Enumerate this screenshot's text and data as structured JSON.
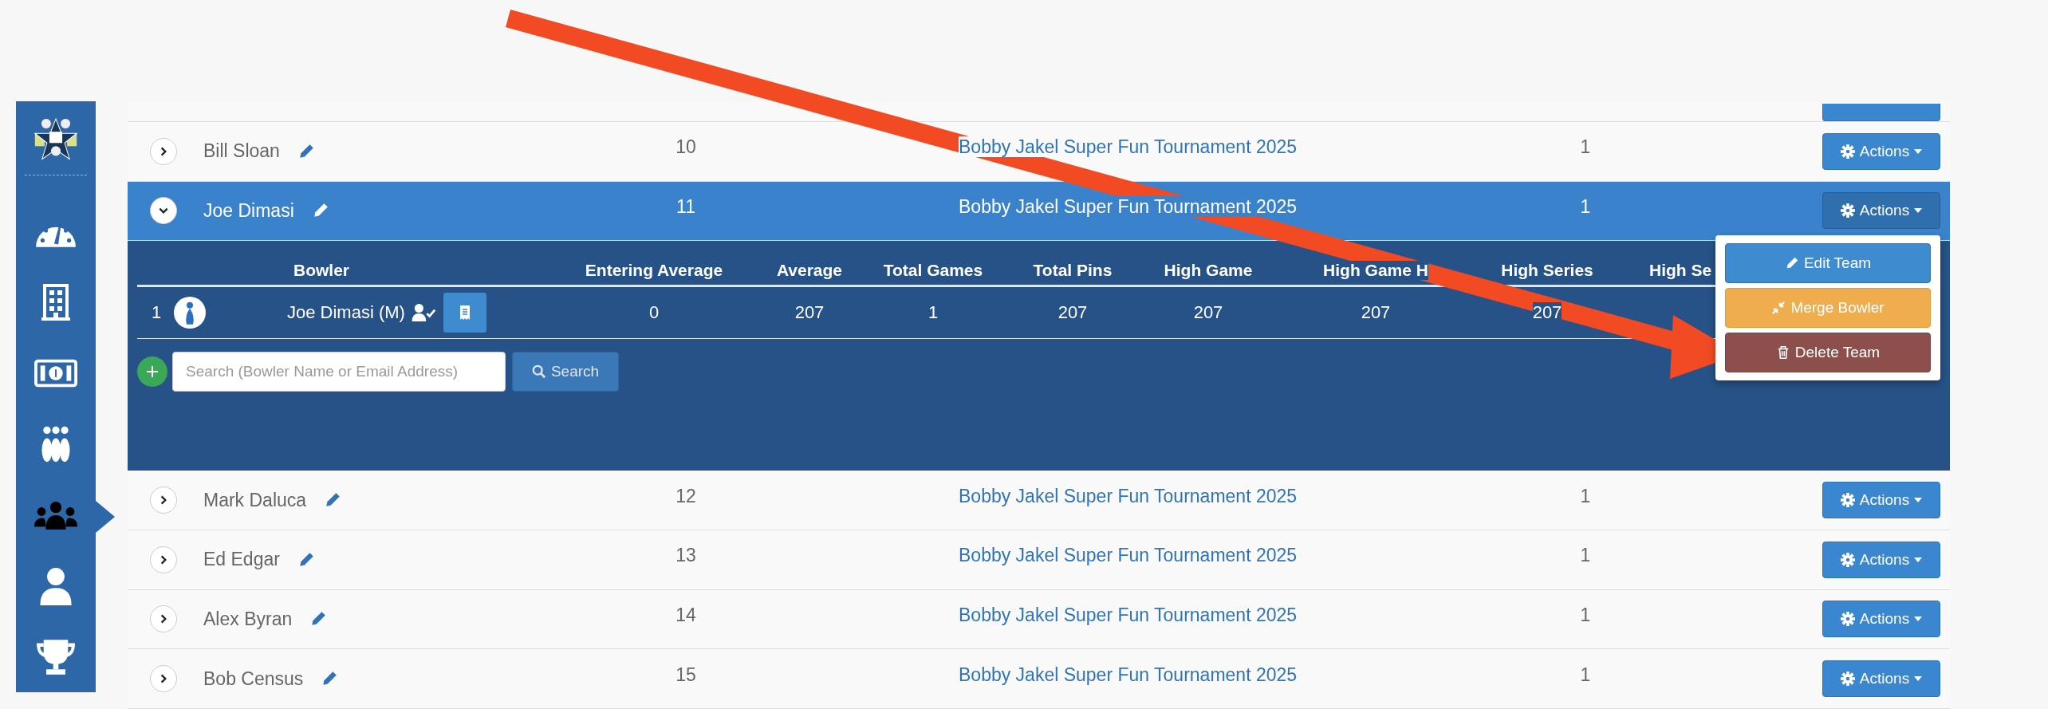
{
  "sidebar": {
    "items": [
      {
        "kind": "gauge",
        "selected": false
      },
      {
        "kind": "building",
        "selected": false
      },
      {
        "kind": "money",
        "selected": false
      },
      {
        "kind": "pins",
        "selected": false
      },
      {
        "kind": "team",
        "selected": true
      },
      {
        "kind": "user",
        "selected": false
      },
      {
        "kind": "trophy",
        "selected": false
      }
    ]
  },
  "teams": [
    {
      "name": "Bill Sloan",
      "number": "10",
      "tournament": "Bobby Jakel Super Fun Tournament 2025",
      "count": "1",
      "actions": "Actions",
      "expanded": false,
      "menu_open": false
    },
    {
      "name": "Joe Dimasi",
      "number": "11",
      "tournament": "Bobby Jakel Super Fun Tournament 2025",
      "count": "1",
      "actions": "Actions",
      "expanded": true,
      "menu_open": true
    },
    {
      "name": "Mark Daluca",
      "number": "12",
      "tournament": "Bobby Jakel Super Fun Tournament 2025",
      "count": "1",
      "actions": "Actions",
      "expanded": false,
      "menu_open": false
    },
    {
      "name": "Ed Edgar",
      "number": "13",
      "tournament": "Bobby Jakel Super Fun Tournament 2025",
      "count": "1",
      "actions": "Actions",
      "expanded": false,
      "menu_open": false
    },
    {
      "name": "Alex Byran",
      "number": "14",
      "tournament": "Bobby Jakel Super Fun Tournament 2025",
      "count": "1",
      "actions": "Actions",
      "expanded": false,
      "menu_open": false
    },
    {
      "name": "Bob Census",
      "number": "15",
      "tournament": "Bobby Jakel Super Fun Tournament 2025",
      "count": "1",
      "actions": "Actions",
      "expanded": false,
      "menu_open": false
    }
  ],
  "actions_menu": [
    {
      "label": "Edit Team",
      "kind": "edit"
    },
    {
      "label": "Merge Bowler",
      "kind": "merge"
    },
    {
      "label": "Delete Team",
      "kind": "delete"
    }
  ],
  "detail": {
    "columns": [
      "Bowler",
      "Entering Average",
      "Average",
      "Total Games",
      "Total Pins",
      "High Game",
      "High Game H",
      "High Series",
      "High Se"
    ],
    "rows": [
      {
        "index": "1",
        "bowler": "Joe Dimasi (M)",
        "values": [
          "0",
          "207",
          "1",
          "207",
          "207",
          "207",
          "207"
        ]
      }
    ],
    "search": {
      "placeholder": "Search (Bowler Name or Email Address)",
      "button": "Search"
    }
  }
}
